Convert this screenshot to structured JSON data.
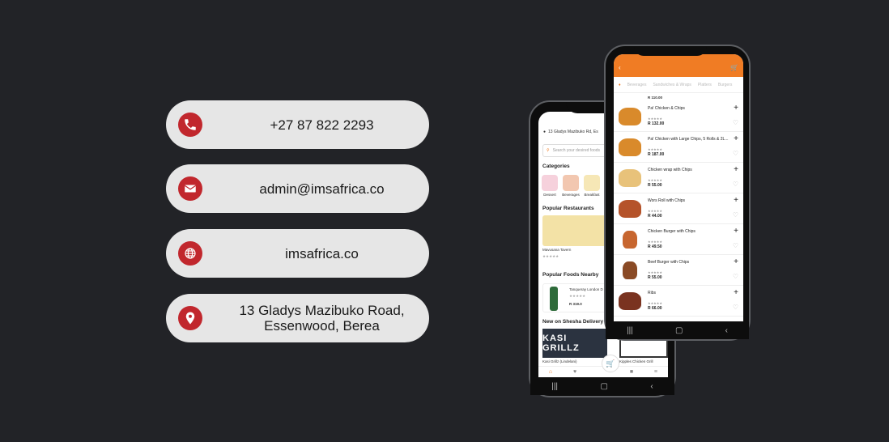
{
  "contacts": [
    {
      "icon": "phone-icon",
      "text": "+27 87 822 2293"
    },
    {
      "icon": "email-icon",
      "text": "admin@imsafrica.co"
    },
    {
      "icon": "globe-icon",
      "text": "imsafrica.co"
    },
    {
      "icon": "location-pin-icon",
      "text": "13 Gladys Mazibuko Road,\nEssenwood, Berea"
    }
  ],
  "colors": {
    "accent": "#c1272d",
    "pill": "#e6e6e6",
    "app_orange": "#f07c24",
    "background": "#222327"
  },
  "home_app": {
    "address": "13 Gladys Mazibuko Rd, Es",
    "search_placeholder": "Search your desired foods",
    "categories_title": "Categories",
    "categories": [
      "Dessert",
      "Beverages",
      "Breakfast"
    ],
    "popular_restaurants_title": "Popular Restaurants",
    "restaurant": {
      "name": "Mavusana Tavern"
    },
    "popular_foods_title": "Popular Foods Nearby",
    "food": {
      "name": "Tanqueray London D",
      "price": "R 319.0"
    },
    "new_title": "New on Shesha Delivery",
    "new_items": [
      "Kasi Grillz (Lindelani)",
      "Kipples Chicken Grill"
    ],
    "kasi_logo": "KASI GRILLZ"
  },
  "menu_app": {
    "tabs": [
      "Beverages",
      "Sandwiches & Wraps",
      "Platters",
      "Burgers"
    ],
    "top_price": "R 110.00",
    "items": [
      {
        "name": "Pa! Chicken & Chips",
        "price": "R 132.00"
      },
      {
        "name": "Pa! Chicken with Large Chips, 5 Rolls & 2L...",
        "price": "R 187.00"
      },
      {
        "name": "Chicken wrap with Chips",
        "price": "R 55.00"
      },
      {
        "name": "Wors Roll with Chips",
        "price": "R 44.00"
      },
      {
        "name": "Chicken Burger with Chips",
        "price": "R 49.50"
      },
      {
        "name": "Beef Burger with Chips",
        "price": "R 55.00"
      },
      {
        "name": "Ribs",
        "price": "R 66.00"
      }
    ]
  }
}
